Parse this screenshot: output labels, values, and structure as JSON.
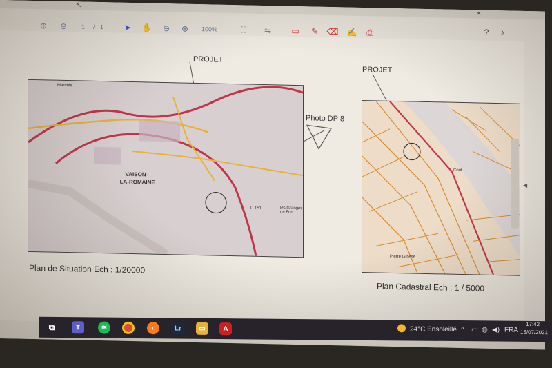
{
  "toolbar": {
    "page_current": "1",
    "page_separator": "/",
    "page_total": "1",
    "zoom": "100%"
  },
  "document": {
    "projet_label_1": "PROJET",
    "projet_label_2": "PROJET",
    "photo_label": "Photo DP 8",
    "caption_left": "Plan de Situation Ech : 1/20000",
    "caption_right": "Plan Cadastral Ech : 1 / 5000",
    "map_town": "VAISON-\n-LA-ROMAINE",
    "map_place_1": "Marmés",
    "map_place_2": "les Granges de Fort",
    "map_place_3": "D 151",
    "map_place_4": "Cout",
    "map_place_5": "Pierre Grosse"
  },
  "taskbar": {
    "weather": "24°C Ensoleillé",
    "lang": "FRA",
    "time": "17:42",
    "date": "15/07/2021",
    "lr_label": "Lr"
  },
  "colors": {
    "screen_bg": "#e9e5dc",
    "taskbar_bg": "#26232a",
    "road_red": "#c0354a",
    "road_yellow": "#e8b23a",
    "parcel_orange": "#d98a2f"
  }
}
